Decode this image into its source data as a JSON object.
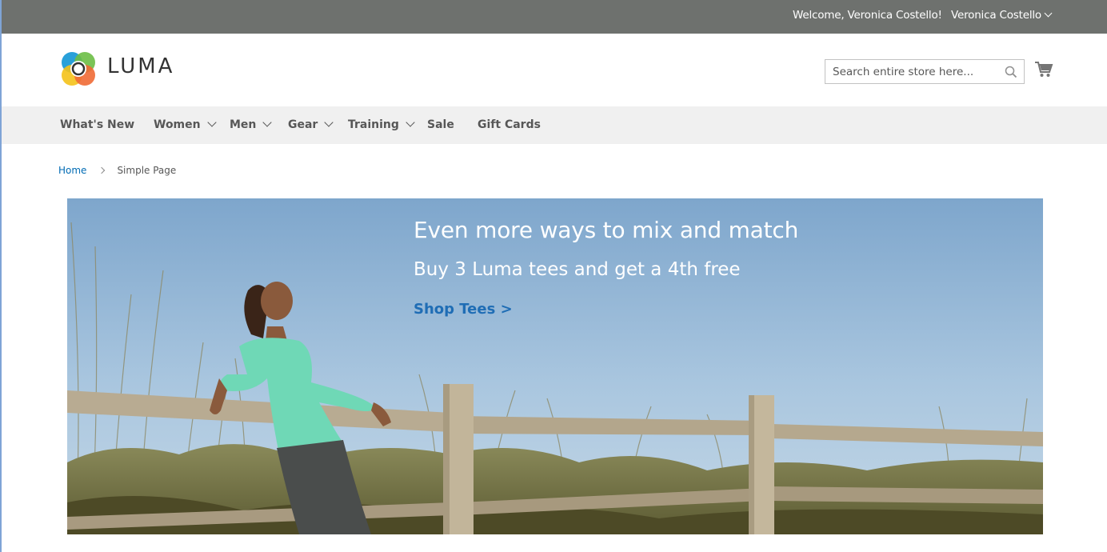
{
  "top_panel": {
    "welcome": "Welcome, Veronica Costello!",
    "account_name": "Veronica Costello"
  },
  "header": {
    "logo_text": "LUMA",
    "search_placeholder": "Search entire store here...",
    "icons": {
      "search": "search-icon",
      "cart": "cart-icon",
      "account_dropdown": "chevron-down-icon"
    }
  },
  "nav": {
    "items": [
      {
        "label": "What's New",
        "has_dropdown": false
      },
      {
        "label": "Women",
        "has_dropdown": true
      },
      {
        "label": "Men",
        "has_dropdown": true
      },
      {
        "label": "Gear",
        "has_dropdown": true
      },
      {
        "label": "Training",
        "has_dropdown": true
      },
      {
        "label": "Sale",
        "has_dropdown": false
      },
      {
        "label": "Gift Cards",
        "has_dropdown": false
      }
    ]
  },
  "breadcrumbs": {
    "home": "Home",
    "current": "Simple Page"
  },
  "hero": {
    "headline": "Even more ways to mix and match",
    "subheadline": "Buy 3 Luma tees and get a 4th free",
    "cta": "Shop Tees >"
  },
  "colors": {
    "top_bar": "#6e716e",
    "nav_bar": "#f0f0f0",
    "link": "#006bb4",
    "cta": "#1f6db5"
  }
}
